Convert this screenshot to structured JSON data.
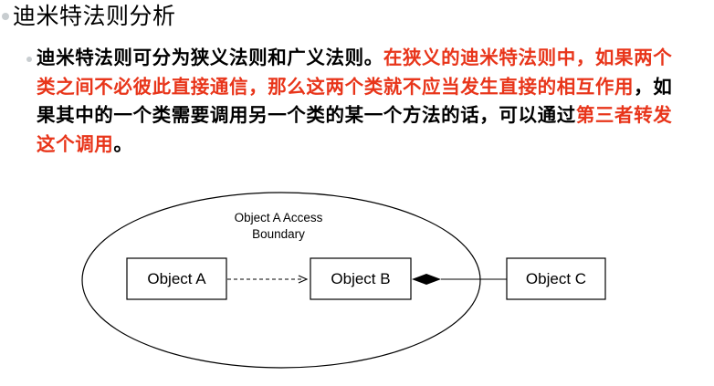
{
  "slide": {
    "title": "迪米特法则分析",
    "paragraph": {
      "seg1": "迪米特法则可分为狭义法则和广义法则。",
      "seg2": "在狭义的迪米特法则中，如果两个类之间不必彼此直接通信，那么这两个类就不应当发生直接的相互作用",
      "seg3": "，如果其中的一个类需要调用另一个类的某一个方法的话，可以通过",
      "seg4": "第三者转发这个调用",
      "seg5": "。"
    },
    "highlight_color": "#e8351a"
  },
  "diagram": {
    "boundary_label_line1": "Object A Access",
    "boundary_label_line2": "Boundary",
    "object_a": "Object A",
    "object_b": "Object B",
    "object_c": "Object C"
  }
}
